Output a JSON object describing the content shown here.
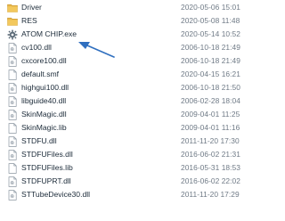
{
  "files": [
    {
      "name": "Driver",
      "date": "2020-05-06 15:01",
      "icon": "folder-icon"
    },
    {
      "name": "RES",
      "date": "2020-05-08 11:48",
      "icon": "folder-icon"
    },
    {
      "name": "ATOM CHIP.exe",
      "date": "2020-05-14 10:52",
      "icon": "exe-gear-icon"
    },
    {
      "name": "cv100.dll",
      "date": "2006-10-18 21:49",
      "icon": "dll-file-icon"
    },
    {
      "name": "cxcore100.dll",
      "date": "2006-10-18 21:49",
      "icon": "dll-file-icon"
    },
    {
      "name": "default.smf",
      "date": "2020-04-15 16:21",
      "icon": "blank-file-icon"
    },
    {
      "name": "highgui100.dll",
      "date": "2006-10-18 21:50",
      "icon": "dll-file-icon"
    },
    {
      "name": "libguide40.dll",
      "date": "2006-02-28 18:04",
      "icon": "dll-file-icon"
    },
    {
      "name": "SkinMagic.dll",
      "date": "2009-04-01 11:25",
      "icon": "dll-file-icon"
    },
    {
      "name": "SkinMagic.lib",
      "date": "2009-04-01 11:16",
      "icon": "blank-file-icon"
    },
    {
      "name": "STDFU.dll",
      "date": "2011-11-20 17:30",
      "icon": "dll-file-icon"
    },
    {
      "name": "STDFUFiles.dll",
      "date": "2016-06-02 21:31",
      "icon": "dll-file-icon"
    },
    {
      "name": "STDFUFiles.lib",
      "date": "2016-05-31 18:53",
      "icon": "blank-file-icon"
    },
    {
      "name": "STDFUPRT.dll",
      "date": "2016-06-02 22:02",
      "icon": "dll-file-icon"
    },
    {
      "name": "STTubeDevice30.dll",
      "date": "2011-11-20 17:29",
      "icon": "dll-file-icon"
    }
  ],
  "colors": {
    "folder": "#e8b84a",
    "arrow": "#2f6fbf",
    "date_text": "#6f7a86"
  }
}
